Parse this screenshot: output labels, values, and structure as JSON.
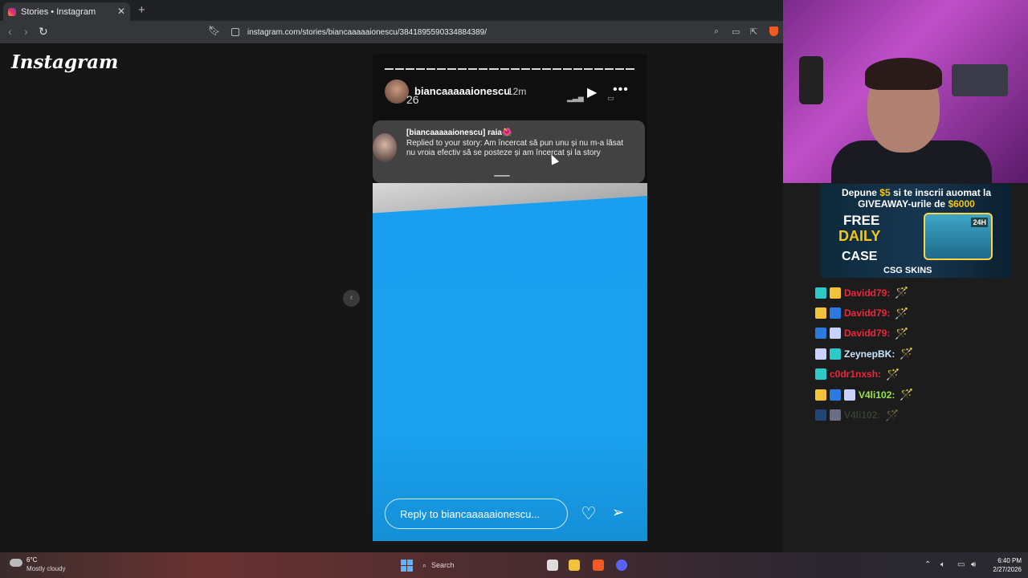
{
  "browser": {
    "tab_title": "Stories • Instagram",
    "url": "instagram.com/stories/biancaaaaaionescu/3841895590334884389/"
  },
  "instagram": {
    "logo": "Instagram"
  },
  "story": {
    "username": "biancaaaaaionescu",
    "time": "12m",
    "overlay_badge": "26",
    "notification": {
      "title": "[biancaaaaaionescu] raia🌺",
      "body": "Replied to your story: Am încercat să pun unu și nu m-a lăsat nu vroia efectiv să se posteze și am încercat și la story"
    },
    "reply_placeholder": "Reply to biancaaaaaionescu..."
  },
  "ad": {
    "line1_a": "Depune ",
    "line1_b": "$5",
    "line1_c": " si te inscrii auomat la",
    "line2_a": "GIVEAWAY-urile de ",
    "line2_b": "$6000",
    "free": "FREE",
    "daily": "DAILY",
    "case": "CASE",
    "brand": "CSG SKINS",
    "chest_label": "24H"
  },
  "chat": [
    {
      "user": "Davidd79:",
      "color": "#e8283c"
    },
    {
      "user": "Davidd79:",
      "color": "#e8283c"
    },
    {
      "user": "Davidd79:",
      "color": "#e8283c"
    },
    {
      "user": "ZeynepBK:",
      "color": "#c9e6ff"
    },
    {
      "user": "c0dr1nxsh:",
      "color": "#e8283c"
    },
    {
      "user": "V4li102:",
      "color": "#9be84a"
    },
    {
      "user": "V4li102:",
      "color": "#5a6a4a"
    }
  ],
  "taskbar": {
    "temp": "6°C",
    "weather": "Mostly cloudy",
    "search": "Search",
    "time": "6:40 PM",
    "date": "2/27/2026"
  },
  "colors": {
    "story_blue": "#1aa0ee",
    "brand_yellow": "#f5c518",
    "chat_wand": "#d77cf0"
  }
}
